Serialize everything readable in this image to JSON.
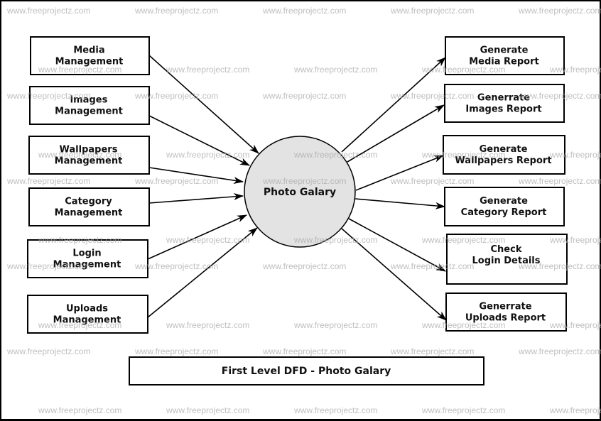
{
  "diagram": {
    "title": "First Level DFD - Photo Galary",
    "center_process": {
      "label": "Photo Galary",
      "fill": "#e3e3e3"
    },
    "left_entities": [
      {
        "id": "media",
        "lines": [
          "Media",
          "Management"
        ]
      },
      {
        "id": "images",
        "lines": [
          "images",
          "Management"
        ]
      },
      {
        "id": "wallpapers",
        "lines": [
          "Wallpapers",
          "Management"
        ]
      },
      {
        "id": "category",
        "lines": [
          "Category",
          "Management"
        ]
      },
      {
        "id": "login",
        "lines": [
          "Login",
          "Management"
        ]
      },
      {
        "id": "uploads",
        "lines": [
          "Uploads",
          "Management"
        ]
      }
    ],
    "right_outputs": [
      {
        "id": "media-report",
        "lines": [
          "Generate",
          "Media Report"
        ]
      },
      {
        "id": "images-report",
        "lines": [
          "Generrate",
          "Images Report"
        ]
      },
      {
        "id": "wallpapers-report",
        "lines": [
          "Generate",
          "Wallpapers Report"
        ]
      },
      {
        "id": "category-report",
        "lines": [
          "Generate",
          "Category Report"
        ]
      },
      {
        "id": "login-details",
        "lines": [
          "Check",
          "Login Details"
        ]
      },
      {
        "id": "uploads-report",
        "lines": [
          "Generrate",
          "Uploads Report"
        ]
      }
    ],
    "flows": [
      {
        "from": "media",
        "to": "center"
      },
      {
        "from": "images",
        "to": "center"
      },
      {
        "from": "wallpapers",
        "to": "center"
      },
      {
        "from": "category",
        "to": "center"
      },
      {
        "from": "login",
        "to": "center"
      },
      {
        "from": "uploads",
        "to": "center"
      },
      {
        "from": "center",
        "to": "media-report"
      },
      {
        "from": "center",
        "to": "images-report"
      },
      {
        "from": "center",
        "to": "wallpapers-report"
      },
      {
        "from": "center",
        "to": "category-report"
      },
      {
        "from": "center",
        "to": "login-details"
      },
      {
        "from": "center",
        "to": "uploads-report"
      }
    ]
  },
  "watermark": {
    "text": "www.freeprojectz.com"
  }
}
